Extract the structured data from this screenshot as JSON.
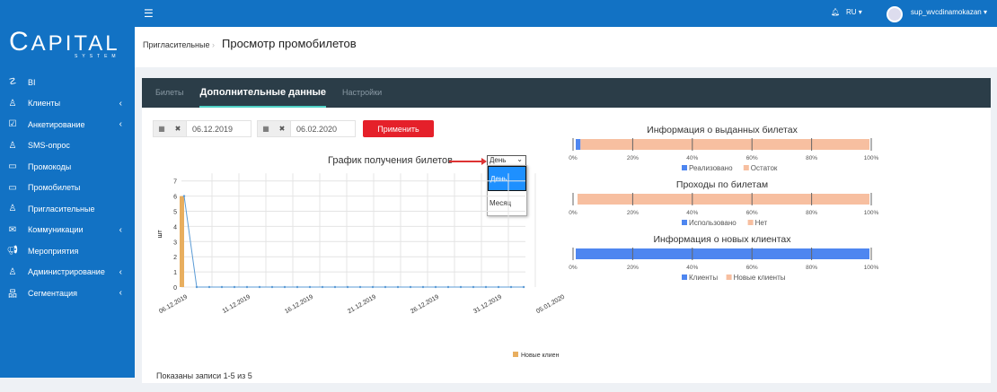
{
  "header": {
    "lang": "RU",
    "user": "sup_wvcdinamokazan"
  },
  "logo": {
    "text": "APITAL",
    "sub": "SYSTEM"
  },
  "sidebar": {
    "items": [
      {
        "label": "BI",
        "icon": "chart-line-icon",
        "chev": false
      },
      {
        "label": "Клиенты",
        "icon": "user-icon",
        "chev": true
      },
      {
        "label": "Анкетирование",
        "icon": "form-check-icon",
        "chev": true
      },
      {
        "label": "SMS-опрос",
        "icon": "user-icon",
        "chev": false
      },
      {
        "label": "Промокоды",
        "icon": "ticket-icon",
        "chev": false
      },
      {
        "label": "Промобилеты",
        "icon": "ticket-icon",
        "chev": false
      },
      {
        "label": "Пригласительные",
        "icon": "user-icon",
        "chev": false
      },
      {
        "label": "Коммуникации",
        "icon": "envelope-icon",
        "chev": true
      },
      {
        "label": "Мероприятия",
        "icon": "megaphone-icon",
        "chev": false
      },
      {
        "label": "Администрирование",
        "icon": "user-icon",
        "chev": true
      },
      {
        "label": "Сегментация",
        "icon": "sitemap-icon",
        "chev": true
      }
    ]
  },
  "breadcrumb": {
    "parent": "Пригласительные",
    "title": "Просмотр промобилетов"
  },
  "tabs": [
    "Билеты",
    "Дополнительные данные",
    "Настройки"
  ],
  "filters": {
    "from": "06.12.2019",
    "to": "06.02.2020",
    "apply": "Применить"
  },
  "period_select": {
    "value": "День",
    "options": [
      "День",
      "Месяц"
    ]
  },
  "footer": {
    "records": "Показаны записи 1-5 из 5"
  },
  "colors": {
    "blue": "#4e86f0",
    "orange": "#f7bfa0",
    "bar": "#e8ae5f",
    "line": "#5b9bd5"
  },
  "chart_data": [
    {
      "type": "bar+line",
      "title": "График получения билетов",
      "ylabel": "шт",
      "ylim": [
        0,
        7
      ],
      "yticks": [
        0,
        1,
        2,
        3,
        4,
        5,
        6,
        7
      ],
      "xtick_labels": [
        "06.12.2019",
        "11.12.2019",
        "16.12.2019",
        "21.12.2019",
        "26.12.2019",
        "31.12.2019",
        "05.01.2020"
      ],
      "x": [
        "06.12",
        "07.12",
        "08.12",
        "09.12",
        "10.12",
        "11.12",
        "12.12",
        "13.12",
        "14.12",
        "15.12",
        "16.12",
        "17.12",
        "18.12",
        "19.12",
        "20.12",
        "21.12",
        "22.12",
        "23.12",
        "24.12",
        "25.12",
        "26.12",
        "27.12",
        "28.12",
        "29.12",
        "30.12",
        "31.12",
        "01.01",
        "02.01"
      ],
      "series": [
        {
          "name": "Новые клиен",
          "type": "bar",
          "values": [
            6,
            0,
            0,
            0,
            0,
            0,
            0,
            0,
            0,
            0,
            0,
            0,
            0,
            0,
            0,
            0,
            0,
            0,
            0,
            0,
            0,
            0,
            0,
            0,
            0,
            0,
            0,
            0
          ]
        },
        {
          "type": "line",
          "values": [
            6,
            0,
            0,
            0,
            0,
            0,
            0,
            0,
            0,
            0,
            0,
            0,
            0,
            0,
            0,
            0,
            0,
            0,
            0,
            0,
            0,
            0,
            0,
            0,
            0,
            0,
            0,
            0
          ]
        }
      ],
      "legend": "bottom-right"
    },
    {
      "type": "stacked-bar-100",
      "title": "Информация о выданных билетах",
      "series": [
        {
          "name": "Реализовано",
          "value": 2.5
        },
        {
          "name": "Остаток",
          "value": 97.5
        }
      ]
    },
    {
      "type": "stacked-bar-100",
      "title": "Проходы по билетам",
      "series": [
        {
          "name": "Использовано",
          "value": 0
        },
        {
          "name": "Нет",
          "value": 100
        }
      ]
    },
    {
      "type": "stacked-bar-100",
      "title": "Информация о новых клиентах",
      "series": [
        {
          "name": "Клиенты",
          "value": 100
        },
        {
          "name": "Новые клиенты",
          "value": 0
        }
      ]
    }
  ],
  "pct_ticks": [
    "0%",
    "20%",
    "40%",
    "60%",
    "80%",
    "100%"
  ]
}
